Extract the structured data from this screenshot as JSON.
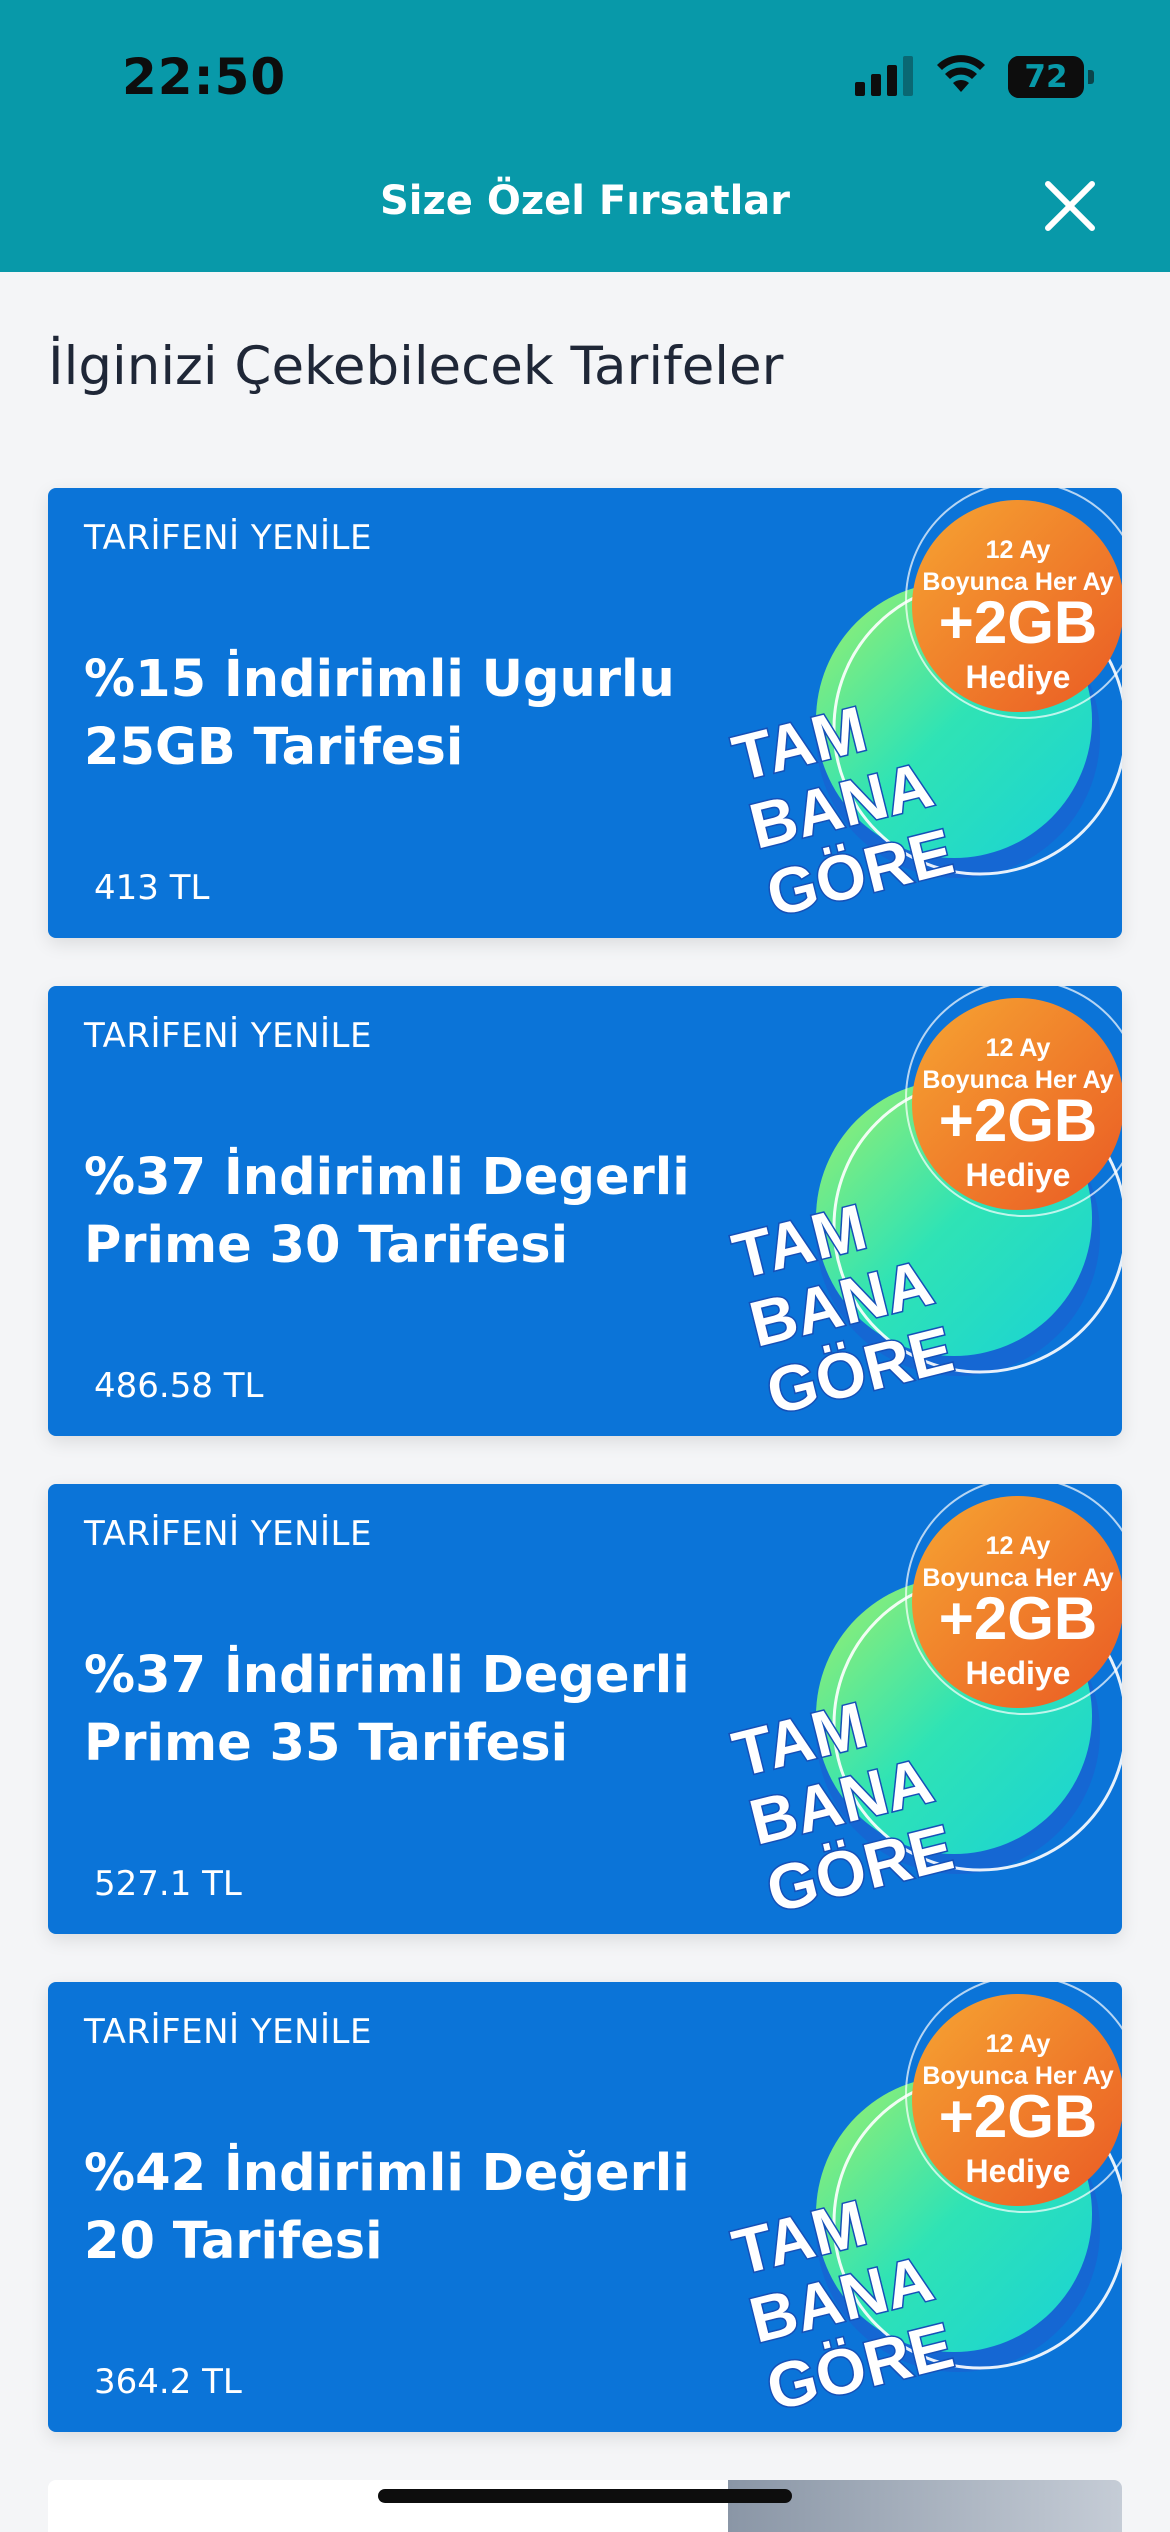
{
  "status_bar": {
    "time": "22:50",
    "battery": "72",
    "battery_level_percent": 72
  },
  "header": {
    "title": "Size Özel Fırsatlar",
    "close_icon": "close-icon"
  },
  "section_title": "İlginizi Çekebilecek Tarifeler",
  "promo": {
    "line1": "12 Ay",
    "line2": "Boyunca Her Ay",
    "line3": "+2GB",
    "line4": "Hediye",
    "brand1": "TAM",
    "brand2": "BANA",
    "brand3": "GÖRE"
  },
  "colors": {
    "header_bg": "#0899a9",
    "card_bg": "#0b74d8",
    "promo_orange": "#f07a2c",
    "promo_green": "#2fe3b5"
  },
  "cards": [
    {
      "badge": "TARİFENİ YENİLE",
      "title": "%15 İndirimli Ugurlu 25GB Tarifesi",
      "price": "413 TL"
    },
    {
      "badge": "TARİFENİ YENİLE",
      "title": "%37 İndirimli Degerli Prime 30 Tarifesi",
      "price": "486.58 TL"
    },
    {
      "badge": "TARİFENİ YENİLE",
      "title": "%37 İndirimli Degerli Prime 35 Tarifesi",
      "price": "527.1 TL"
    },
    {
      "badge": "TARİFENİ YENİLE",
      "title": "%42 İndirimli Değerli 20 Tarifesi",
      "price": "364.2 TL"
    }
  ]
}
